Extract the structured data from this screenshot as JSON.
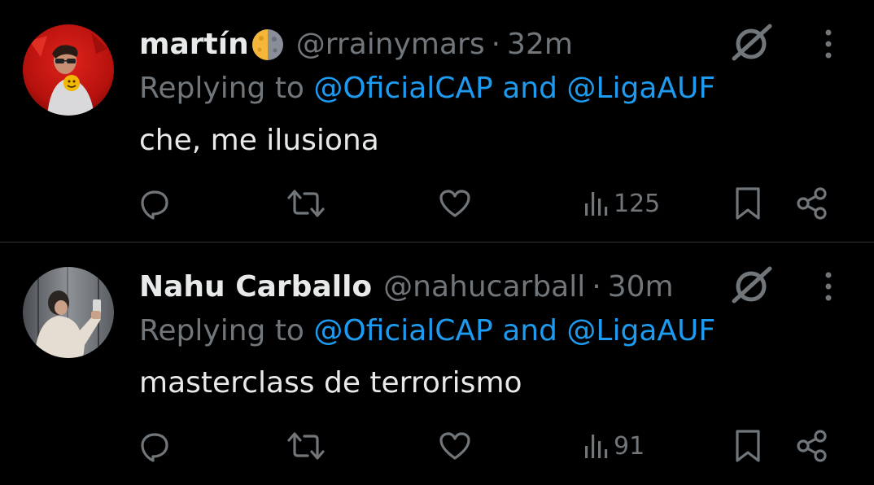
{
  "colors": {
    "background": "#000000",
    "primary_text": "#e7e9ea",
    "secondary_text": "#71767b",
    "link": "#1d9bf0",
    "divider": "#2f3336"
  },
  "tweets": [
    {
      "display_name": "martín",
      "name_emoji": "first-quarter-moon-emoji",
      "handle": "@rrainymars",
      "separator": "·",
      "time": "32m",
      "replying_prefix": "Replying to",
      "mention_1": "@OficialCAP",
      "mention_join": "and",
      "mention_2": "@LigaAUF",
      "text": "che, me ilusiona",
      "views": "125",
      "icons": [
        "grok-icon",
        "more-options-icon",
        "reply-icon",
        "retweet-icon",
        "like-icon",
        "views-icon",
        "bookmark-icon",
        "share-icon"
      ]
    },
    {
      "display_name": "Nahu Carballo",
      "handle": "@nahucarball",
      "separator": "·",
      "time": "30m",
      "replying_prefix": "Replying to",
      "mention_1": "@OficialCAP",
      "mention_join": "and",
      "mention_2": "@LigaAUF",
      "text": "masterclass de terrorismo",
      "views": "91",
      "icons": [
        "grok-icon",
        "more-options-icon",
        "reply-icon",
        "retweet-icon",
        "like-icon",
        "views-icon",
        "bookmark-icon",
        "share-icon"
      ]
    }
  ]
}
